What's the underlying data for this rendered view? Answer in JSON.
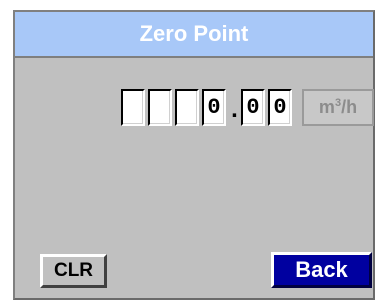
{
  "title": "Zero Point",
  "entry": {
    "digits": [
      "",
      "",
      "",
      "0"
    ],
    "decimal_point": ".",
    "decimals": [
      "0",
      "0"
    ],
    "unit_base": "m",
    "unit_exponent": "3",
    "unit_suffix": "/h"
  },
  "buttons": {
    "clear_label": "CLR",
    "back_label": "Back"
  },
  "colors": {
    "title_bar": "#a8c8f8",
    "panel": "#c0c0c0",
    "back_button": "#0000a0"
  }
}
